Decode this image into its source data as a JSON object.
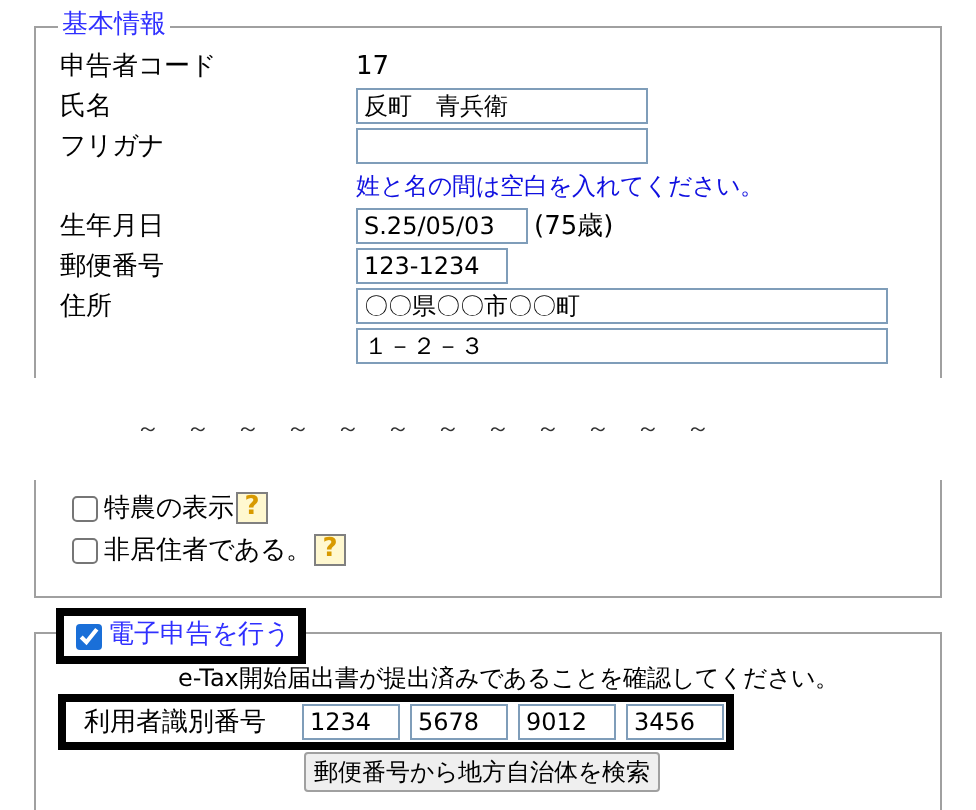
{
  "basic_info": {
    "legend": "基本情報",
    "rows": [
      {
        "kind": "text",
        "label": "申告者コード",
        "value": "17"
      },
      {
        "kind": "name",
        "label": "氏名",
        "value": "反町　青兵衛"
      },
      {
        "kind": "name",
        "label": "フリガナ"
      },
      {
        "kind": "note",
        "value": "姓と名の間は空白を入れてください。"
      },
      {
        "kind": "date",
        "label": "生年月日",
        "value": "S.25/05/03",
        "suffix": "(75歳)"
      },
      {
        "kind": "postal",
        "label": "郵便番号",
        "value": "123-1234"
      },
      {
        "kind": "address",
        "label": "住所",
        "value": "〇〇県〇〇市〇〇町"
      },
      {
        "kind": "address",
        "value": "１－２－３"
      }
    ]
  },
  "separator": [
    "～",
    "～",
    "～",
    "～",
    "～",
    "～",
    "～",
    "～",
    "～",
    "～",
    "～",
    "～"
  ],
  "options": [
    {
      "label": "特農の表示",
      "checked": false,
      "help": "?"
    },
    {
      "label": "非居住者である。",
      "checked": false,
      "help": "?"
    }
  ],
  "e_filing": {
    "label": "電子申告を行う",
    "checked": true,
    "highlighted": true,
    "notice": "e-Tax開始届出書が提出済みであることを確認してください。",
    "user_id": {
      "label": "利用者識別番号",
      "highlighted": true,
      "values": [
        "1234",
        "5678",
        "9012",
        "3456"
      ]
    },
    "button": "郵便番号から地方自治体を検索"
  }
}
